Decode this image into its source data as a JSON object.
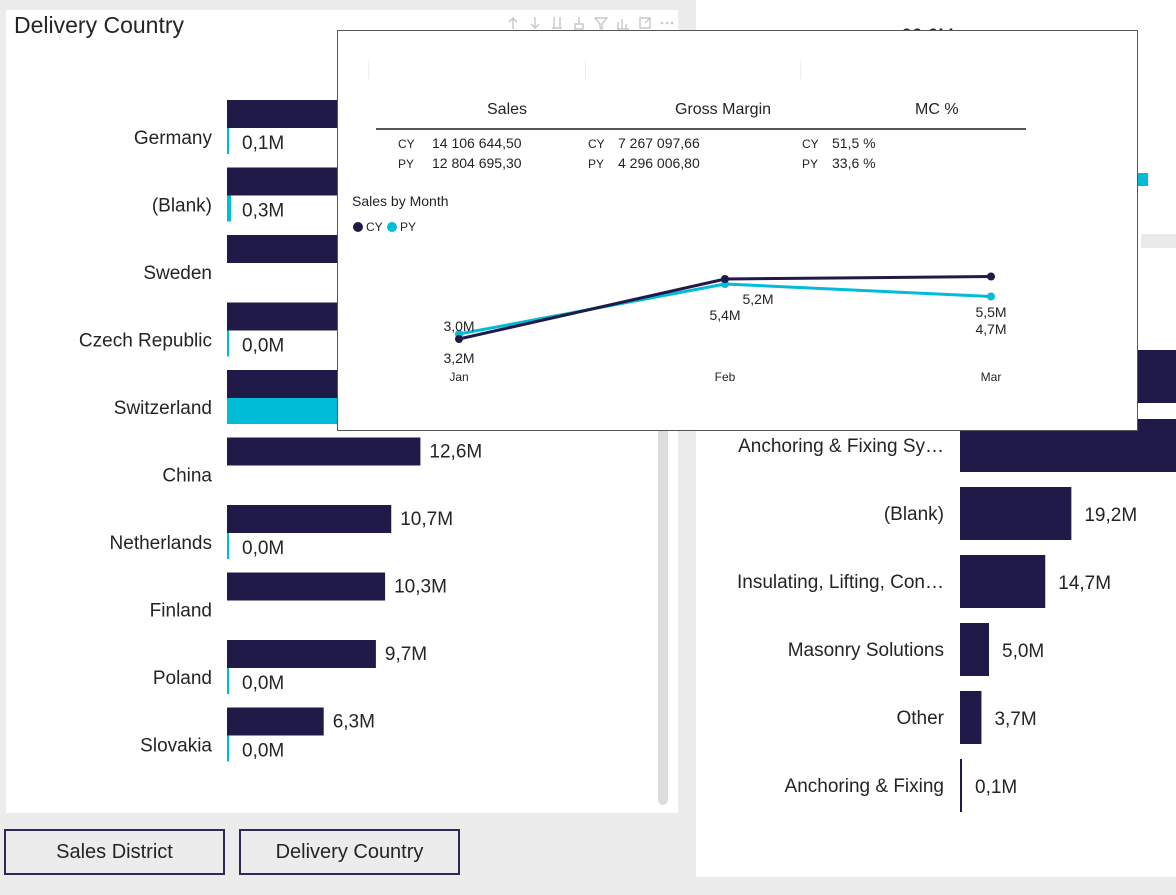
{
  "colors": {
    "cy": "#201a48",
    "py": "#00bcd6",
    "background": "#ececec",
    "panel": "#ffffff"
  },
  "left_visual": {
    "title": "Delivery Country",
    "toolbar_icons": [
      "arrow-up-icon",
      "arrow-down-icon",
      "drill-all-icon",
      "expand-hierarchy-icon",
      "filter-icon",
      "focus-chart-icon",
      "focus-mode-icon",
      "more-options-icon"
    ]
  },
  "chart_data": [
    {
      "type": "bar",
      "categories": [
        "Germany",
        "(Blank)",
        "Sweden",
        "Czech Republic",
        "Switzerland",
        "China",
        "Netherlands",
        "Finland",
        "Poland",
        "Slovakia"
      ],
      "series": [
        {
          "name": "CY",
          "values": [
            null,
            null,
            null,
            null,
            null,
            12.6,
            10.7,
            10.3,
            9.7,
            6.3
          ],
          "labels": [
            "",
            "",
            "",
            "",
            "",
            "12,6M",
            "10,7M",
            "10,3M",
            "9,7M",
            "6,3M"
          ]
        },
        {
          "name": "PY",
          "values": [
            0.1,
            0.3,
            null,
            0.0,
            null,
            null,
            0.0,
            null,
            0.0,
            0.0
          ],
          "labels": [
            "0,1M",
            "0,3M",
            "",
            "0,0M",
            "",
            "",
            "0,0M",
            "",
            "0,0M",
            "0,0M"
          ]
        }
      ],
      "title": "Delivery Country"
    },
    {
      "type": "bar",
      "categories": [
        "Anchoring & Fixing Sy…",
        "(Blank)",
        "Insulating, Lifting, Con…",
        "Masonry Solutions",
        "Other",
        "Anchoring & Fixing"
      ],
      "series": [
        {
          "name": "CY",
          "values": [
            null,
            19.2,
            14.7,
            5.0,
            3.7,
            0.1
          ],
          "labels": [
            "",
            "19,2M",
            "14,7M",
            "5,0M",
            "3,7M",
            "0,1M"
          ]
        }
      ],
      "partially_hidden_label": "66,6M"
    },
    {
      "type": "line",
      "title": "Sales by Month",
      "x": [
        "Jan",
        "Feb",
        "Mar"
      ],
      "series": [
        {
          "name": "CY",
          "values": [
            3.0,
            5.4,
            5.5
          ],
          "labels": [
            "3,0M",
            "5,4M",
            "5,5M"
          ]
        },
        {
          "name": "PY",
          "values": [
            3.2,
            5.2,
            4.7
          ],
          "labels": [
            "3,2M",
            "5,2M",
            "4,7M"
          ]
        }
      ],
      "ylim": [
        2.0,
        6.0
      ],
      "grid": false
    }
  ],
  "tooltip": {
    "headers": [
      "Sales",
      "Gross Margin",
      "MC %"
    ],
    "rows": [
      {
        "label": "CY",
        "sales": "14 106 644,50",
        "gross_margin": "7 267 097,66",
        "mc": "51,5 %"
      },
      {
        "label": "PY",
        "sales": "12 804 695,30",
        "gross_margin": "4 296 006,80",
        "mc": "33,6 %"
      }
    ],
    "chart_caption": "Sales by Month",
    "legend": [
      "CY",
      "PY"
    ]
  },
  "slicers": {
    "sales_district": "Sales District",
    "delivery_country": "Delivery Country"
  }
}
